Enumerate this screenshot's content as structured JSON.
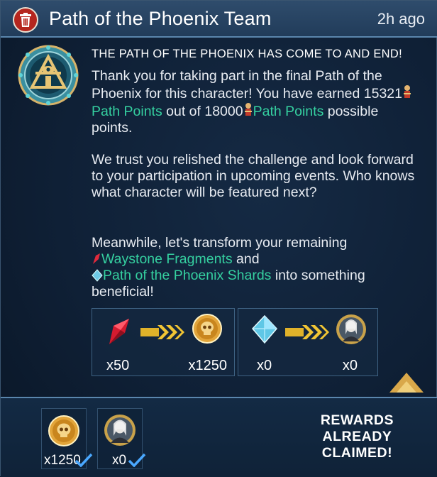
{
  "header": {
    "title": "Path of the Phoenix Team",
    "time": "2h ago",
    "delete_icon": "trash-icon"
  },
  "message": {
    "headline": "THE PATH OF THE PHOENIX HAS COME TO AND END!",
    "p1_a": "Thank you for taking part in the final Path of the Phoenix for this character! You have earned 15321",
    "p1_link1": "Path Points",
    "p1_b": " out of 18000",
    "p1_link2": "Path Points",
    "p1_c": " possible points.",
    "p2": "We trust you relished the challenge and look forward to your participation in upcoming events. Who knows what character will be featured next?",
    "p3_a": "Meanwhile, let's transform your remaining",
    "p3_link1": "Waystone Fragments",
    "p3_b": " and",
    "p3_link2": "Path of the Phoenix Shards",
    "p3_c": " into something beneficial!"
  },
  "conversions": [
    {
      "from_icon": "red-fragment-icon",
      "from_qty": "x50",
      "to_icon": "skull-coin-icon",
      "to_qty": "x1250"
    },
    {
      "from_icon": "blue-crystal-icon",
      "from_qty": "x0",
      "to_icon": "hero-portrait-icon",
      "to_qty": "x0"
    }
  ],
  "rewards": {
    "items": [
      {
        "icon": "skull-coin-icon",
        "qty": "x1250"
      },
      {
        "icon": "hero-portrait-icon",
        "qty": "x0"
      }
    ],
    "status_line1": "REWARDS",
    "status_line2": "ALREADY",
    "status_line3": "CLAIMED!"
  },
  "colors": {
    "highlight": "#35d0a0",
    "header_bg": "#2a4766",
    "trash_red": "#b5261e",
    "check_blue": "#4aa8ff"
  }
}
